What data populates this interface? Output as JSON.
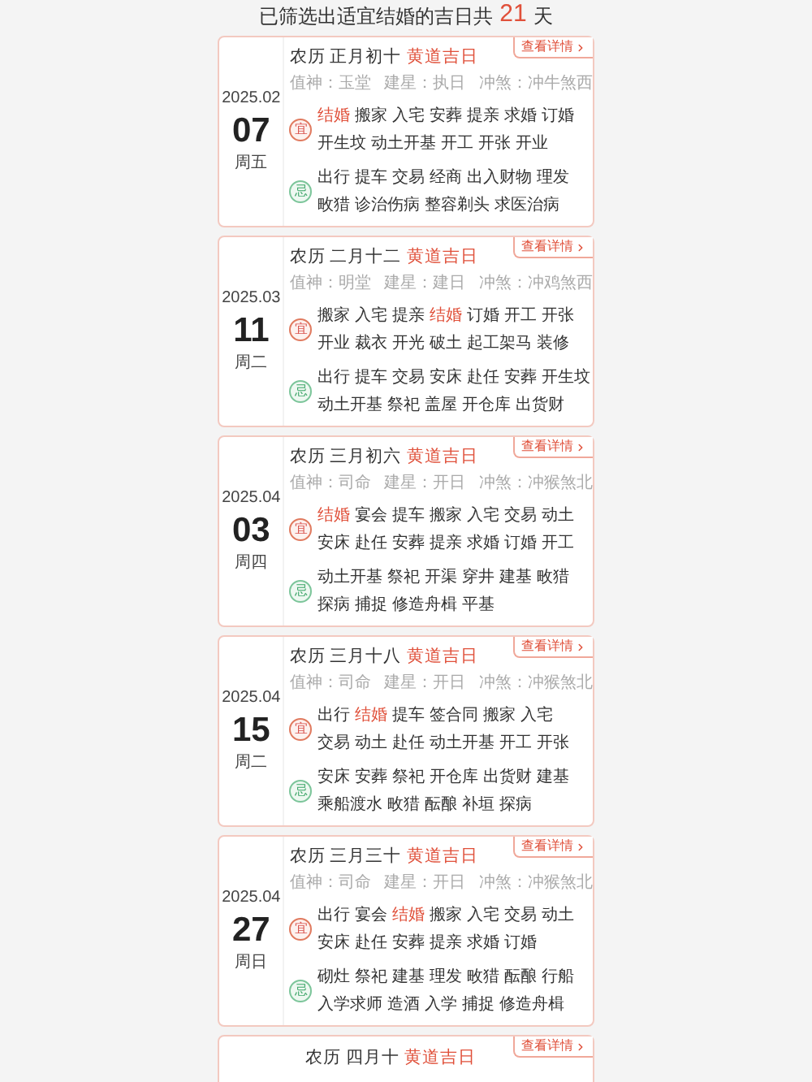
{
  "header": {
    "prefix": "已筛选出适宜结婚的吉日共",
    "count": "21",
    "suffix": "天"
  },
  "cards": [
    {
      "date": "2025.02",
      "day": "07",
      "weekday": "周五",
      "lunar": "农历 正月初十",
      "tag": "黄道吉日",
      "detail": "查看详情",
      "shen": "值神：玉堂   建星：执日   冲煞：冲牛煞西",
      "sections": [
        {
          "kind": "yi",
          "label": "宜",
          "lines": [
            [
              {
                "text": "结婚",
                "highlight": true
              },
              {
                "text": "搬家",
                "highlight": false
              },
              {
                "text": "入宅",
                "highlight": false
              },
              {
                "text": "安葬",
                "highlight": false
              },
              {
                "text": "提亲",
                "highlight": false
              },
              {
                "text": "求婚",
                "highlight": false
              },
              {
                "text": "订婚",
                "highlight": false
              }
            ],
            [
              {
                "text": "开生坟",
                "highlight": false
              },
              {
                "text": "动土开基",
                "highlight": false
              },
              {
                "text": "开工",
                "highlight": false
              },
              {
                "text": "开张",
                "highlight": false
              },
              {
                "text": "开业",
                "highlight": false
              }
            ]
          ]
        },
        {
          "kind": "ji",
          "label": "忌",
          "lines": [
            [
              {
                "text": "出行",
                "highlight": false
              },
              {
                "text": "提车",
                "highlight": false
              },
              {
                "text": "交易",
                "highlight": false
              },
              {
                "text": "经商",
                "highlight": false
              },
              {
                "text": "出入财物",
                "highlight": false
              },
              {
                "text": "理发",
                "highlight": false
              }
            ],
            [
              {
                "text": "畋猎",
                "highlight": false
              },
              {
                "text": "诊治伤病",
                "highlight": false
              },
              {
                "text": "整容剃头",
                "highlight": false
              },
              {
                "text": "求医治病",
                "highlight": false
              }
            ]
          ]
        }
      ]
    },
    {
      "date": "2025.03",
      "day": "11",
      "weekday": "周二",
      "lunar": "农历 二月十二",
      "tag": "黄道吉日",
      "detail": "查看详情",
      "shen": "值神：明堂   建星：建日   冲煞：冲鸡煞西",
      "sections": [
        {
          "kind": "yi",
          "label": "宜",
          "lines": [
            [
              {
                "text": "搬家",
                "highlight": false
              },
              {
                "text": "入宅",
                "highlight": false
              },
              {
                "text": "提亲",
                "highlight": false
              },
              {
                "text": "结婚",
                "highlight": true
              },
              {
                "text": "订婚",
                "highlight": false
              },
              {
                "text": "开工",
                "highlight": false
              },
              {
                "text": "开张",
                "highlight": false
              }
            ],
            [
              {
                "text": "开业",
                "highlight": false
              },
              {
                "text": "裁衣",
                "highlight": false
              },
              {
                "text": "开光",
                "highlight": false
              },
              {
                "text": "破土",
                "highlight": false
              },
              {
                "text": "起工架马",
                "highlight": false
              },
              {
                "text": "装修",
                "highlight": false
              }
            ]
          ]
        },
        {
          "kind": "ji",
          "label": "忌",
          "lines": [
            [
              {
                "text": "出行",
                "highlight": false
              },
              {
                "text": "提车",
                "highlight": false
              },
              {
                "text": "交易",
                "highlight": false
              },
              {
                "text": "安床",
                "highlight": false
              },
              {
                "text": "赴任",
                "highlight": false
              },
              {
                "text": "安葬",
                "highlight": false
              },
              {
                "text": "开生坟",
                "highlight": false
              }
            ],
            [
              {
                "text": "动土开基",
                "highlight": false
              },
              {
                "text": "祭祀",
                "highlight": false
              },
              {
                "text": "盖屋",
                "highlight": false
              },
              {
                "text": "开仓库",
                "highlight": false
              },
              {
                "text": "出货财",
                "highlight": false
              }
            ]
          ]
        }
      ]
    },
    {
      "date": "2025.04",
      "day": "03",
      "weekday": "周四",
      "lunar": "农历 三月初六",
      "tag": "黄道吉日",
      "detail": "查看详情",
      "shen": "值神：司命   建星：开日   冲煞：冲猴煞北",
      "sections": [
        {
          "kind": "yi",
          "label": "宜",
          "lines": [
            [
              {
                "text": "结婚",
                "highlight": true
              },
              {
                "text": "宴会",
                "highlight": false
              },
              {
                "text": "提车",
                "highlight": false
              },
              {
                "text": "搬家",
                "highlight": false
              },
              {
                "text": "入宅",
                "highlight": false
              },
              {
                "text": "交易",
                "highlight": false
              },
              {
                "text": "动土",
                "highlight": false
              }
            ],
            [
              {
                "text": "安床",
                "highlight": false
              },
              {
                "text": "赴任",
                "highlight": false
              },
              {
                "text": "安葬",
                "highlight": false
              },
              {
                "text": "提亲",
                "highlight": false
              },
              {
                "text": "求婚",
                "highlight": false
              },
              {
                "text": "订婚",
                "highlight": false
              },
              {
                "text": "开工",
                "highlight": false
              }
            ]
          ]
        },
        {
          "kind": "ji",
          "label": "忌",
          "lines": [
            [
              {
                "text": "动土开基",
                "highlight": false
              },
              {
                "text": "祭祀",
                "highlight": false
              },
              {
                "text": "开渠",
                "highlight": false
              },
              {
                "text": "穿井",
                "highlight": false
              },
              {
                "text": "建基",
                "highlight": false
              },
              {
                "text": "畋猎",
                "highlight": false
              }
            ],
            [
              {
                "text": "探病",
                "highlight": false
              },
              {
                "text": "捕捉",
                "highlight": false
              },
              {
                "text": "修造舟楫",
                "highlight": false
              },
              {
                "text": "平基",
                "highlight": false
              }
            ]
          ]
        }
      ]
    },
    {
      "date": "2025.04",
      "day": "15",
      "weekday": "周二",
      "lunar": "农历 三月十八",
      "tag": "黄道吉日",
      "detail": "查看详情",
      "shen": "值神：司命   建星：开日   冲煞：冲猴煞北",
      "sections": [
        {
          "kind": "yi",
          "label": "宜",
          "lines": [
            [
              {
                "text": "出行",
                "highlight": false
              },
              {
                "text": "结婚",
                "highlight": true
              },
              {
                "text": "提车",
                "highlight": false
              },
              {
                "text": "签合同",
                "highlight": false
              },
              {
                "text": "搬家",
                "highlight": false
              },
              {
                "text": "入宅",
                "highlight": false
              }
            ],
            [
              {
                "text": "交易",
                "highlight": false
              },
              {
                "text": "动土",
                "highlight": false
              },
              {
                "text": "赴任",
                "highlight": false
              },
              {
                "text": "动土开基",
                "highlight": false
              },
              {
                "text": "开工",
                "highlight": false
              },
              {
                "text": "开张",
                "highlight": false
              }
            ]
          ]
        },
        {
          "kind": "ji",
          "label": "忌",
          "lines": [
            [
              {
                "text": "安床",
                "highlight": false
              },
              {
                "text": "安葬",
                "highlight": false
              },
              {
                "text": "祭祀",
                "highlight": false
              },
              {
                "text": "开仓库",
                "highlight": false
              },
              {
                "text": "出货财",
                "highlight": false
              },
              {
                "text": "建基",
                "highlight": false
              }
            ],
            [
              {
                "text": "乘船渡水",
                "highlight": false
              },
              {
                "text": "畋猎",
                "highlight": false
              },
              {
                "text": "酝酿",
                "highlight": false
              },
              {
                "text": "补垣",
                "highlight": false
              },
              {
                "text": "探病",
                "highlight": false
              }
            ]
          ]
        }
      ]
    },
    {
      "date": "2025.04",
      "day": "27",
      "weekday": "周日",
      "lunar": "农历 三月三十",
      "tag": "黄道吉日",
      "detail": "查看详情",
      "shen": "值神：司命   建星：开日   冲煞：冲猴煞北",
      "sections": [
        {
          "kind": "yi",
          "label": "宜",
          "lines": [
            [
              {
                "text": "出行",
                "highlight": false
              },
              {
                "text": "宴会",
                "highlight": false
              },
              {
                "text": "结婚",
                "highlight": true
              },
              {
                "text": "搬家",
                "highlight": false
              },
              {
                "text": "入宅",
                "highlight": false
              },
              {
                "text": "交易",
                "highlight": false
              },
              {
                "text": "动土",
                "highlight": false
              }
            ],
            [
              {
                "text": "安床",
                "highlight": false
              },
              {
                "text": "赴任",
                "highlight": false
              },
              {
                "text": "安葬",
                "highlight": false
              },
              {
                "text": "提亲",
                "highlight": false
              },
              {
                "text": "求婚",
                "highlight": false
              },
              {
                "text": "订婚",
                "highlight": false
              }
            ]
          ]
        },
        {
          "kind": "ji",
          "label": "忌",
          "lines": [
            [
              {
                "text": "砌灶",
                "highlight": false
              },
              {
                "text": "祭祀",
                "highlight": false
              },
              {
                "text": "建基",
                "highlight": false
              },
              {
                "text": "理发",
                "highlight": false
              },
              {
                "text": "畋猎",
                "highlight": false
              },
              {
                "text": "酝酿",
                "highlight": false
              },
              {
                "text": "行船",
                "highlight": false
              }
            ],
            [
              {
                "text": "入学求师",
                "highlight": false
              },
              {
                "text": "造酒",
                "highlight": false
              },
              {
                "text": "入学",
                "highlight": false
              },
              {
                "text": "捕捉",
                "highlight": false
              },
              {
                "text": "修造舟楫",
                "highlight": false
              }
            ]
          ]
        }
      ]
    },
    {
      "lunar": "农历 四月十",
      "tag": "黄道吉日",
      "detail": "查看详情"
    }
  ]
}
